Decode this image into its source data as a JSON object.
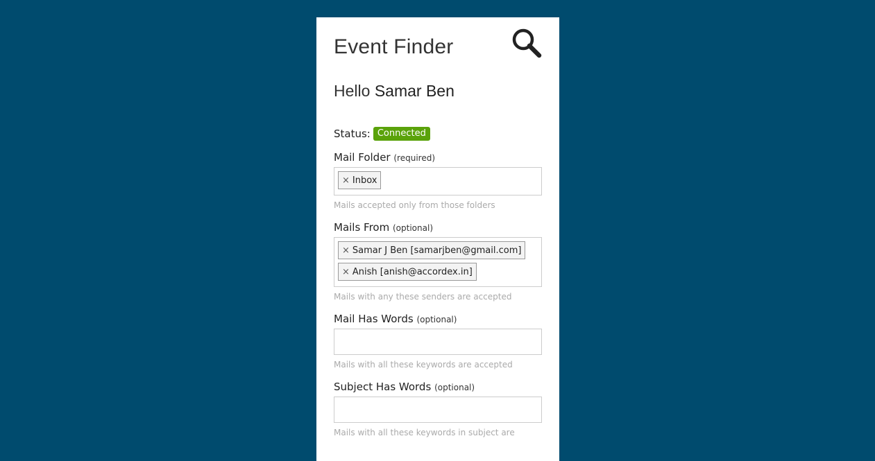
{
  "app": {
    "title": "Event Finder"
  },
  "greeting": {
    "prefix": "Hello",
    "name": "Samar Ben"
  },
  "status": {
    "label": "Status:",
    "value": "Connected",
    "color": "#5aa20a"
  },
  "fields": {
    "mail_folder": {
      "label": "Mail Folder",
      "qualifier": "(required)",
      "tags": [
        "Inbox"
      ],
      "help": "Mails accepted only from those folders"
    },
    "mails_from": {
      "label": "Mails From",
      "qualifier": "(optional)",
      "tags": [
        "Samar J Ben [samarjben@gmail.com]",
        "Anish [anish@accordex.in]"
      ],
      "help": "Mails with any these senders are accepted"
    },
    "mail_has_words": {
      "label": "Mail Has Words",
      "qualifier": "(optional)",
      "value": "",
      "help": "Mails with all these keywords are accepted"
    },
    "subject_has_words": {
      "label": "Subject Has Words",
      "qualifier": "(optional)",
      "value": "",
      "help": "Mails with all these keywords in subject are"
    }
  },
  "icons": {
    "search": "search-icon",
    "remove": "remove-tag-icon"
  },
  "colors": {
    "background": "#004b6e",
    "panel": "#ffffff"
  }
}
